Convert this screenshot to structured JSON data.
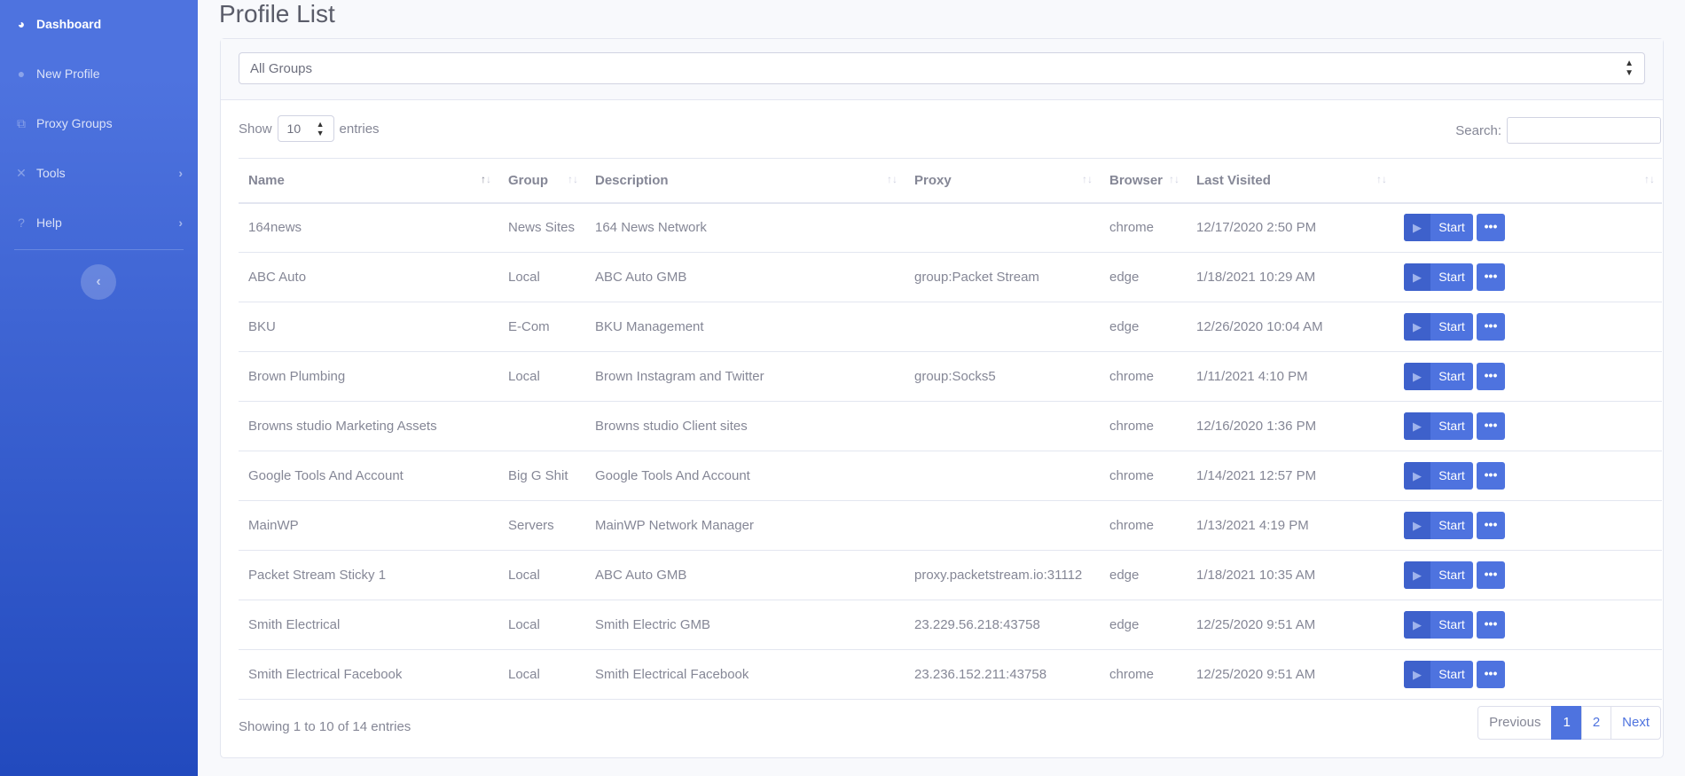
{
  "sidebar": {
    "items": [
      {
        "label": "Dashboard",
        "icon": "tachometer-icon",
        "glyph": "◕",
        "active": true
      },
      {
        "label": "New Profile",
        "icon": "user-icon",
        "glyph": "●"
      },
      {
        "label": "Proxy Groups",
        "icon": "sitemap-icon",
        "glyph": "⧉"
      },
      {
        "label": "Tools",
        "icon": "tools-icon",
        "glyph": "✕",
        "chevron": "›"
      },
      {
        "label": "Help",
        "icon": "question-circle-icon",
        "glyph": "?",
        "chevron": "›"
      }
    ],
    "collapse_glyph": "‹"
  },
  "page": {
    "title": "Profile List"
  },
  "filter": {
    "group_select": "All Groups"
  },
  "table_controls": {
    "show_label": "Show",
    "page_length": "10",
    "entries_label": "entries",
    "search_label": "Search:",
    "search_value": ""
  },
  "columns": [
    "Name",
    "Group",
    "Description",
    "Proxy",
    "Browser",
    "Last Visited",
    ""
  ],
  "rows": [
    {
      "name": "164news",
      "group": "News Sites",
      "description": "164 News Network",
      "proxy": "",
      "browser": "chrome",
      "last": "12/17/2020 2:50 PM"
    },
    {
      "name": "ABC Auto",
      "group": "Local",
      "description": "ABC Auto GMB",
      "proxy": "group:Packet Stream",
      "browser": "edge",
      "last": "1/18/2021 10:29 AM"
    },
    {
      "name": "BKU",
      "group": "E-Com",
      "description": "BKU Management",
      "proxy": "",
      "browser": "edge",
      "last": "12/26/2020 10:04 AM"
    },
    {
      "name": "Brown Plumbing",
      "group": "Local",
      "description": "Brown Instagram and Twitter",
      "proxy": "group:Socks5",
      "browser": "chrome",
      "last": "1/11/2021 4:10 PM"
    },
    {
      "name": "Browns studio Marketing Assets",
      "group": "",
      "description": "Browns studio Client sites",
      "proxy": "",
      "browser": "chrome",
      "last": "12/16/2020 1:36 PM"
    },
    {
      "name": "Google Tools And Account",
      "group": "Big G Shit",
      "description": "Google Tools And Account",
      "proxy": "",
      "browser": "chrome",
      "last": "1/14/2021 12:57 PM"
    },
    {
      "name": "MainWP",
      "group": "Servers",
      "description": "MainWP Network Manager",
      "proxy": "",
      "browser": "chrome",
      "last": "1/13/2021 4:19 PM"
    },
    {
      "name": "Packet Stream Sticky 1",
      "group": "Local",
      "description": "ABC Auto GMB",
      "proxy": "proxy.packetstream.io:31112",
      "browser": "edge",
      "last": "1/18/2021 10:35 AM"
    },
    {
      "name": "Smith Electrical",
      "group": "Local",
      "description": "Smith Electric GMB",
      "proxy": "23.229.56.218:43758",
      "browser": "edge",
      "last": "12/25/2020 9:51 AM"
    },
    {
      "name": "Smith Electrical Facebook",
      "group": "Local",
      "description": "Smith Electrical Facebook",
      "proxy": "23.236.152.211:43758",
      "browser": "chrome",
      "last": "12/25/2020 9:51 AM"
    }
  ],
  "row_actions": {
    "start_label": "Start",
    "more_label": "•••"
  },
  "footer": {
    "info": "Showing 1 to 10 of 14 entries",
    "pagination": {
      "previous": "Previous",
      "pages": [
        "1",
        "2"
      ],
      "current": "1",
      "next": "Next"
    }
  },
  "colors": {
    "primary": "#4e73df",
    "sidebar_end": "#224abe",
    "text": "#858796"
  }
}
